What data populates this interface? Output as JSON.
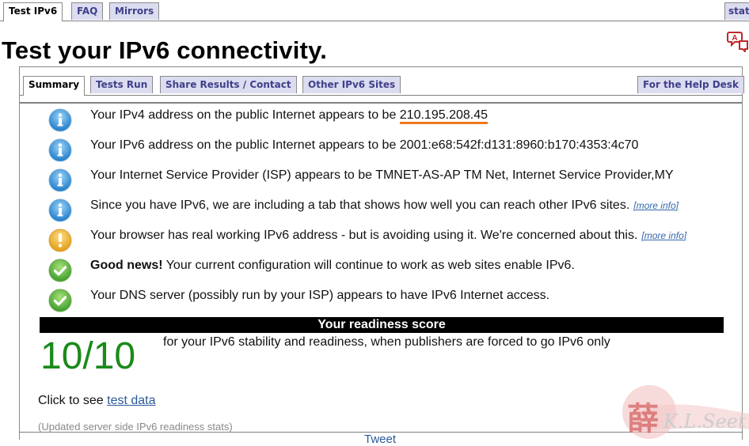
{
  "top_tabs": [
    {
      "label": "Test IPv6",
      "active": true
    },
    {
      "label": "FAQ",
      "active": false
    },
    {
      "label": "Mirrors",
      "active": false
    },
    {
      "label": "stat",
      "active": false
    }
  ],
  "page_title": "Test your IPv6 connectivity.",
  "inner_tabs": [
    {
      "label": "Summary",
      "active": true
    },
    {
      "label": "Tests Run",
      "active": false
    },
    {
      "label": "Share Results / Contact",
      "active": false
    },
    {
      "label": "Other IPv6 Sites",
      "active": false
    },
    {
      "label": "For the Help Desk",
      "active": false
    }
  ],
  "results": [
    {
      "icon": "info-icon",
      "text": "Your IPv4 address on the public Internet appears to be ",
      "value": "210.195.208.45"
    },
    {
      "icon": "info-icon",
      "text": "Your IPv6 address on the public Internet appears to be 2001:e68:542f:d131:8960:b170:4353:4c70"
    },
    {
      "icon": "info-icon",
      "text": "Your Internet Service Provider (ISP) appears to be TMNET-AS-AP TM Net, Internet Service Provider,MY"
    },
    {
      "icon": "info-icon",
      "text": "Since you have IPv6, we are including a tab that shows how well you can reach other IPv6 sites.",
      "link": "[more info]"
    },
    {
      "icon": "warning-icon",
      "text": "Your browser has real working IPv6 address - but is avoiding using it. We're concerned about this.",
      "link": "[more info]"
    },
    {
      "icon": "check-icon",
      "bold": "Good news!",
      "text": " Your current configuration will continue to work as web sites enable IPv6."
    },
    {
      "icon": "check-icon",
      "text": "Your DNS server (possibly run by your ISP) appears to have IPv6 Internet access."
    }
  ],
  "readiness": {
    "header": "Your readiness score",
    "score": "10/10",
    "description": "for your IPv6 stability and readiness, when publishers are forced to go IPv6 only"
  },
  "footer": {
    "click_prefix": "Click to see ",
    "test_data_link": "test data",
    "updated": "(Updated server side IPv6 readiness stats)",
    "tweet": "Tweet"
  },
  "watermark": {
    "text": "K.L.Seet"
  },
  "colors": {
    "tab_bg": "#dcdcf0",
    "tab_text": "#3f3f8a",
    "score_green": "#1a8a1a",
    "highlight_underline": "#f07820",
    "link": "#3366aa"
  }
}
